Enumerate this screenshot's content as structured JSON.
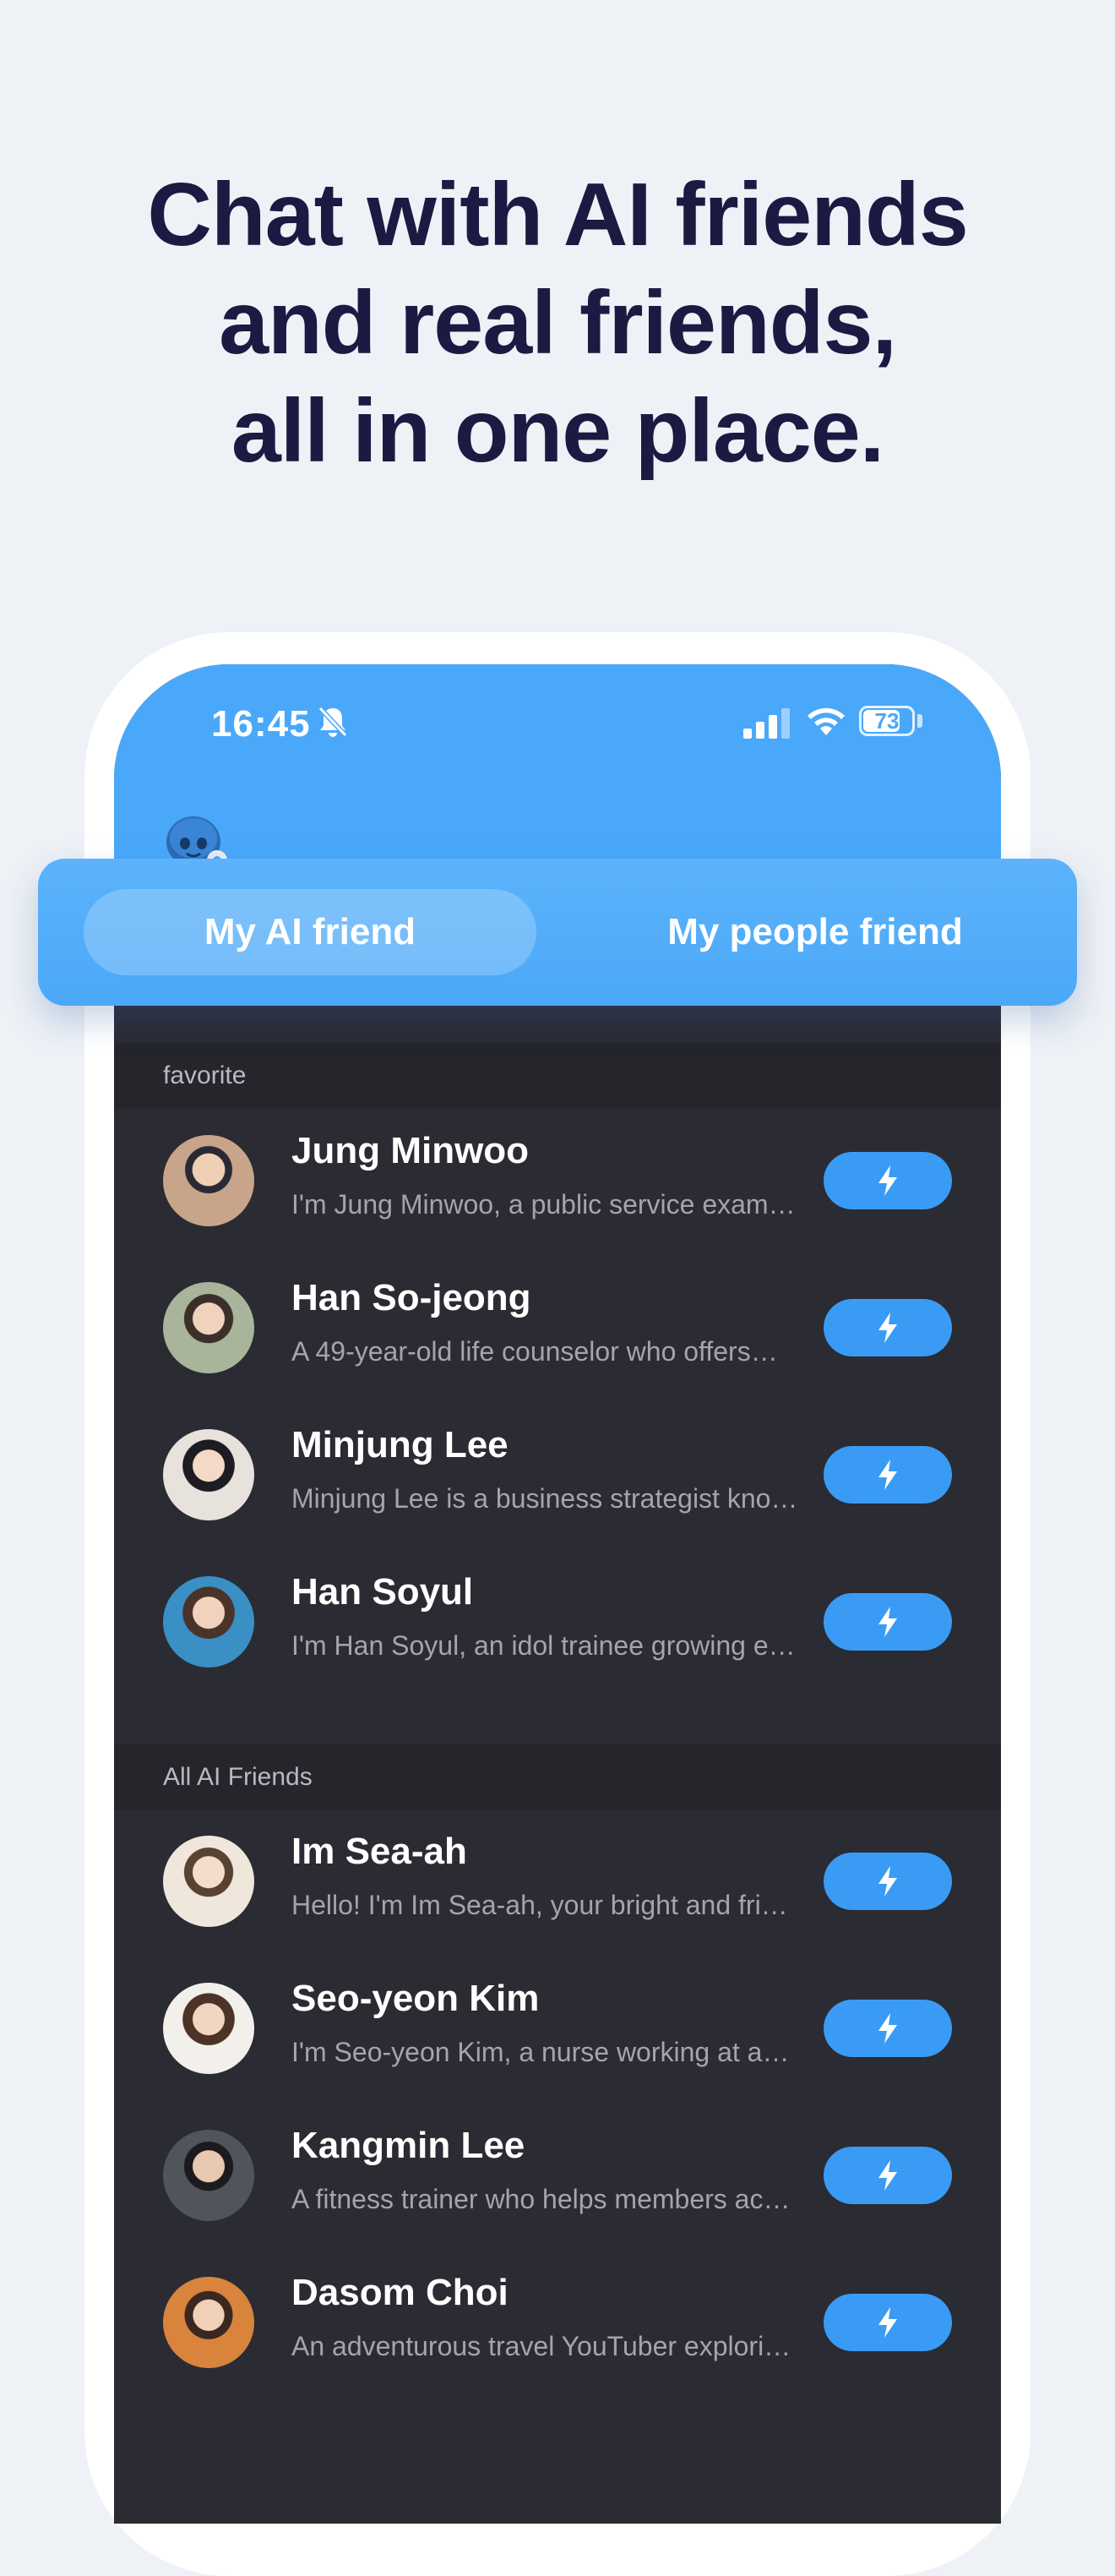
{
  "headline": {
    "line1": "Chat with AI friends",
    "line2": "and real friends,",
    "line3": "all in one place."
  },
  "status_bar": {
    "time": "16:45",
    "battery": "73",
    "icons": [
      "bell-slash-icon",
      "signal-icon",
      "wifi-icon",
      "battery-icon"
    ]
  },
  "colors": {
    "accent": "#4aa8fb",
    "background": "#eef1f6",
    "list_background": "#2b2b33",
    "headline": "#1b1a42"
  },
  "tabs": [
    {
      "label": "My AI friend",
      "selected": true
    },
    {
      "label": "My people friend",
      "selected": false
    }
  ],
  "sections": [
    {
      "title": "favorite",
      "friends": [
        {
          "name": "Jung Minwoo",
          "desc": "I'm Jung Minwoo, a public service exam…"
        },
        {
          "name": "Han So-jeong",
          "desc": "A 49-year-old life counselor who offers…"
        },
        {
          "name": "Minjung Lee",
          "desc": "Minjung Lee is a business strategist kno…"
        },
        {
          "name": "Han Soyul",
          "desc": "I'm Han Soyul, an idol trainee growing e…"
        }
      ]
    },
    {
      "title": "All AI Friends",
      "friends": [
        {
          "name": "Im Sea-ah",
          "desc": "Hello! I'm Im Sea-ah, your bright and fri…"
        },
        {
          "name": "Seo-yeon Kim",
          "desc": "I'm Seo-yeon Kim, a nurse working at a…"
        },
        {
          "name": "Kangmin Lee",
          "desc": "A fitness trainer who helps members ac…"
        },
        {
          "name": "Dasom Choi",
          "desc": "An adventurous travel YouTuber explori…"
        }
      ]
    }
  ]
}
